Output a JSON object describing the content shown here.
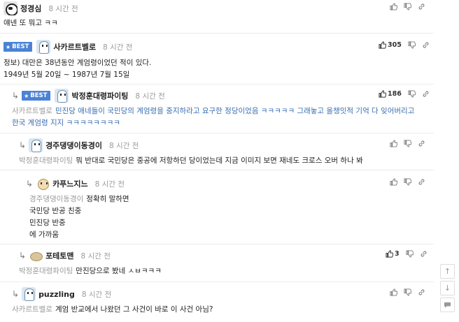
{
  "comments": [
    {
      "name": "정경심",
      "time": "8 시간 전",
      "lines": [
        "얘넨 또 뭐고 ㅋㅋ"
      ],
      "likes": ""
    },
    {
      "best": "BEST",
      "name": "사카르트벨로",
      "time": "8 시간 전",
      "lines": [
        "정보) 대만은 38년동안 계엄령이었던 적이 있다.",
        "1949년 5월 20일 ~ 1987년 7월 15일"
      ],
      "likes": "305"
    },
    {
      "best": "BEST",
      "name": "박정훈대령파이팅",
      "time": "8 시간 전",
      "mention": "사카르트벨로",
      "lines": [
        "민진당 애네들이 국민당의 계엄령을 중지하라고 요구한 정당이었음 ㅋㅋㅋㅋㅋ 그래놓고 올챙잇적 기억 다 잊어버리고",
        "한국 계엄령 지지 ㅋㅋㅋㅋㅋㅋㅋㅋ"
      ],
      "likes": "186"
    },
    {
      "name": "경주댕댕이동경이",
      "time": "8 시간 전",
      "mention": "박정훈대령파이팅",
      "lines": [
        "뭐 반대로 국민당은 중공에 저항하던 당이었는데 지금 이미지 보면 재네도 크로스 오버 하나 봐"
      ],
      "likes": ""
    },
    {
      "name": "카푸느지느",
      "time": "8 시간 전",
      "mention": "경주댕댕이동경이",
      "lines": [
        "정확히 말하면",
        "국민당 반공 친중",
        "민진당 반중",
        "에 가까움"
      ],
      "likes": ""
    },
    {
      "name": "포테토맨",
      "time": "8 시간 전",
      "mention": "박정훈대령파이팅",
      "lines": [
        "만진당으로 봤네 ㅅㅂㅋㅋㅋ"
      ],
      "likes": "3"
    },
    {
      "name": "puzzling",
      "time": "8 시간 전",
      "mention": "사카르트벨로",
      "lines": [
        "계엄 반교에서 나왔던 그 사건이 바로 이 사건 아님?"
      ],
      "likes": ""
    }
  ],
  "icons": {
    "like": "thumbs-up-icon",
    "dislike": "thumbs-down-icon",
    "link": "link-icon",
    "reply": "reply-arrow-icon",
    "star": "star-icon"
  },
  "side_buttons": [
    "scroll-up-icon",
    "scroll-down-icon",
    "comment-icon"
  ],
  "colors": {
    "best_badge": "#4a82d6",
    "highlight_text": "#3a6fb0",
    "mention": "#9a9a9a"
  }
}
